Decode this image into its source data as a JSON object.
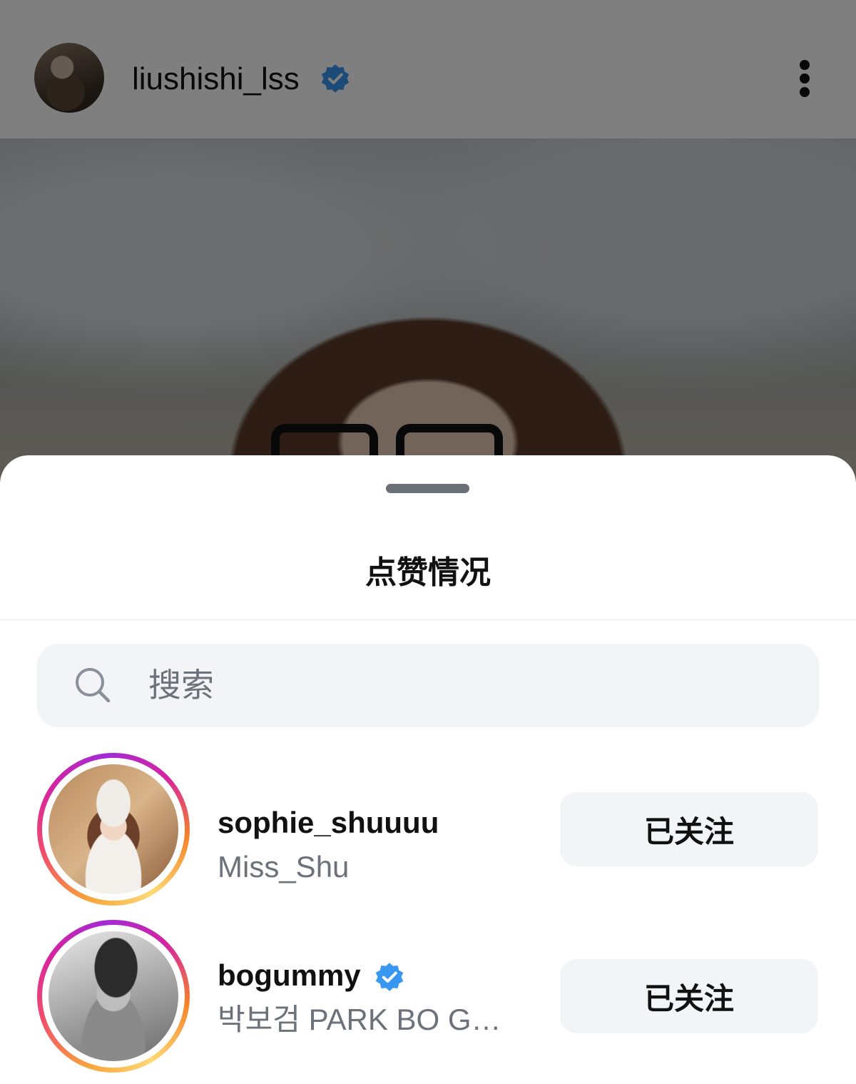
{
  "post": {
    "username": "liushishi_lss",
    "verified": true
  },
  "sheet": {
    "title": "点赞情况",
    "search": {
      "placeholder": "搜索",
      "value": ""
    },
    "users": [
      {
        "username": "sophie_shuuuu",
        "subtitle": "Miss_Shu",
        "verified": false,
        "button_label": "已关注"
      },
      {
        "username": "bogummy",
        "subtitle": "박보검 PARK BO G…",
        "verified": true,
        "button_label": "已关注"
      }
    ]
  },
  "colors": {
    "verified_blue": "#3897f0",
    "button_bg": "#f2f4f7",
    "secondary_text": "#6c727a",
    "overlay": "rgba(0,0,0,0.5)"
  },
  "icons": {
    "verified": "verified-badge-icon",
    "more": "more-vertical-icon",
    "search": "search-icon"
  }
}
